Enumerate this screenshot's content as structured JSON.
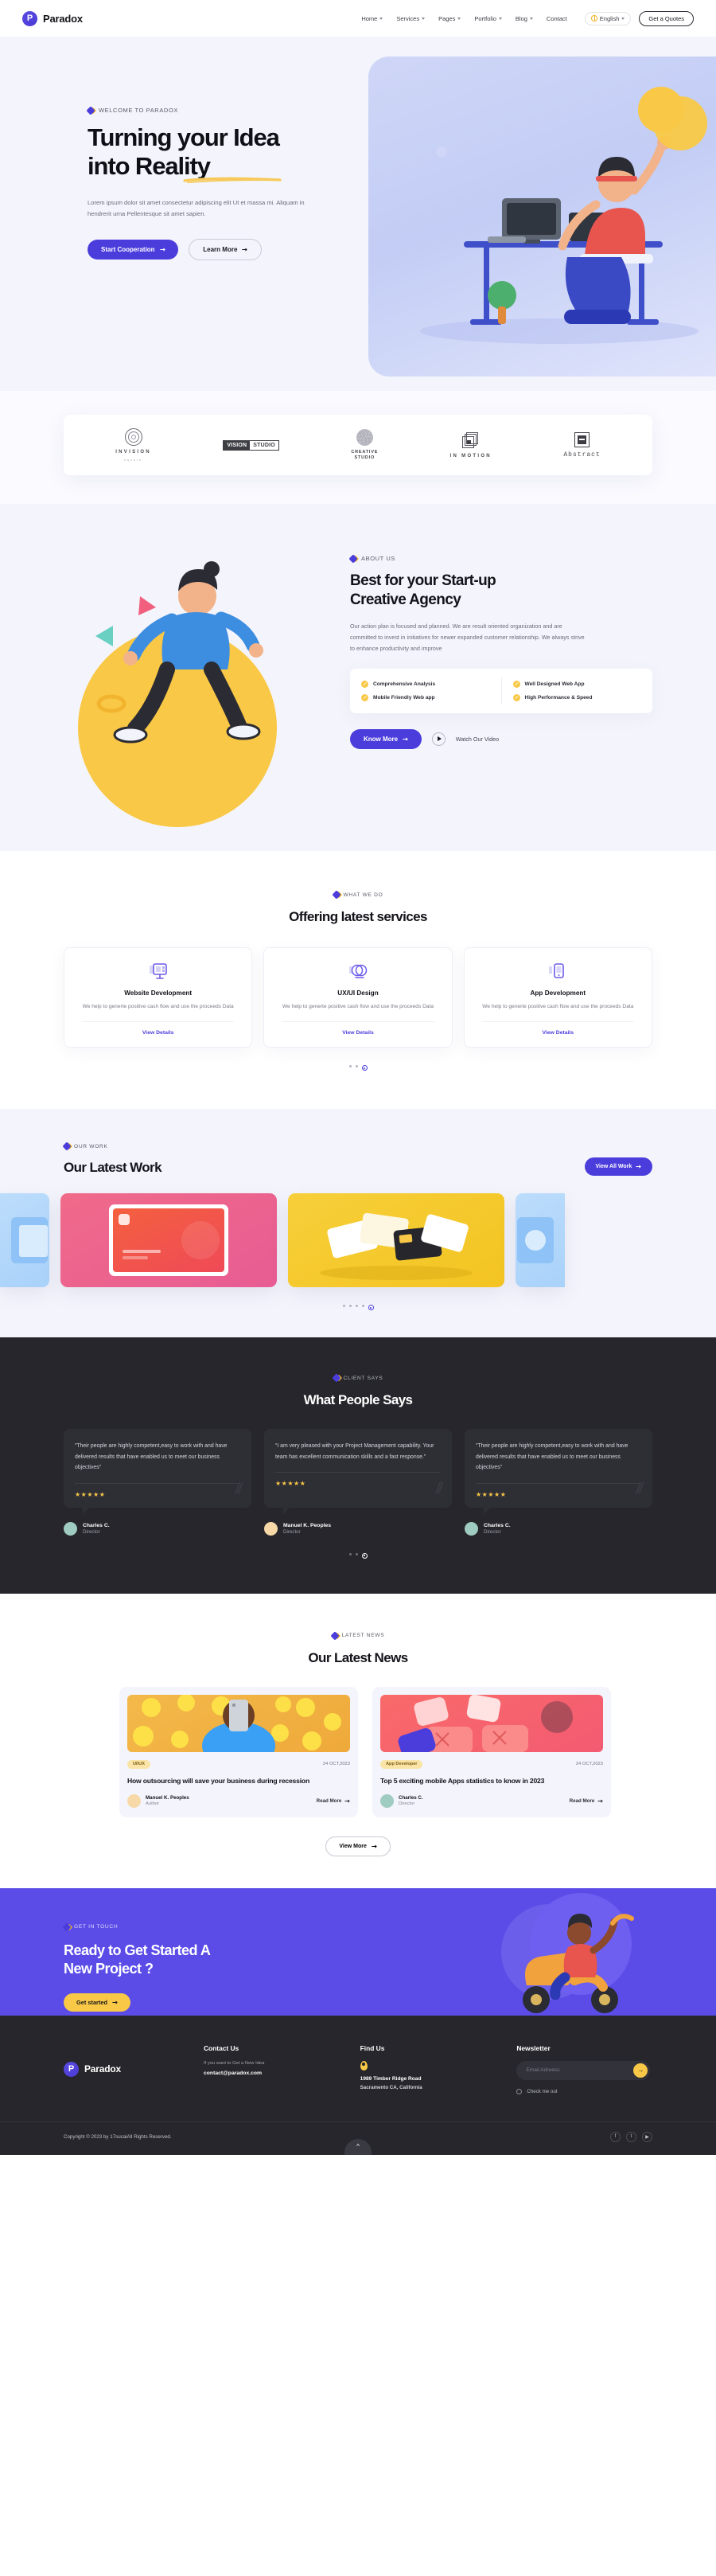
{
  "brand": {
    "name": "Paradox",
    "mark": "P"
  },
  "nav": {
    "links": [
      {
        "label": "Home",
        "has_caret": true
      },
      {
        "label": "Services",
        "has_caret": true
      },
      {
        "label": "Pages",
        "has_caret": true
      },
      {
        "label": "Portfolio",
        "has_caret": true
      },
      {
        "label": "Blog",
        "has_caret": true
      },
      {
        "label": "Contact",
        "has_caret": false
      }
    ],
    "language": "English",
    "quote_button": "Get a Quotes"
  },
  "hero": {
    "eyebrow": "WELCOME TO PARADOX",
    "title_line1": "Turning your Idea",
    "title_line2": "into Reality",
    "subtitle": "Lorem ipsum dolor sit amet consectetur adipiscing elit Ut et massa mi. Aliquam in hendrerit urna Pellentesque sit amet sapien.",
    "primary_button": "Start Cooperation",
    "secondary_button": "Learn More"
  },
  "logos": [
    {
      "name": "INVISION",
      "sub": "square",
      "icon": "mandala-icon"
    },
    {
      "name": "VISION STUDIO",
      "a": "VISION",
      "b": "STUDIO",
      "icon": "vision-studio-icon"
    },
    {
      "name": "CREATIVE STUDIO",
      "line1": "CREATIVE",
      "line2": "STUDIO",
      "icon": "creative-studio-icon"
    },
    {
      "name": "IN MOTION",
      "icon": "in-motion-icon"
    },
    {
      "name": "Abstract",
      "icon": "abstract-icon"
    }
  ],
  "about": {
    "eyebrow": "ABOUT US",
    "title_line1": "Best for your Start-up",
    "title_line2": "Creative Agency",
    "paragraph": "Our action plan is focused and planned. We are result oriented organization and are committed to invest in initiatives for newer expanded customer relationship. We always strive to enhance productivity and improve",
    "features_left": [
      "Comprehensive Analysis",
      "Mobile Friendly Web app"
    ],
    "features_right": [
      "Well Designed Web App",
      "High Performance & Speed"
    ],
    "cta_button": "Know More",
    "video_label": "Watch Our Video"
  },
  "services": {
    "eyebrow": "WHAT WE DO",
    "title": "Offering latest services",
    "cards": [
      {
        "icon": "monitor-icon",
        "name": "Website Development",
        "desc": "We help to generte positive cash flow and use the proceeds Data",
        "link": "View Details"
      },
      {
        "icon": "venn-icon",
        "name": "UX/UI Design",
        "desc": "We help to generte positive cash flow and use the proceeds Data",
        "link": "View Details"
      },
      {
        "icon": "mobile-icon",
        "name": "App Development",
        "desc": "We help to generte positive cash flow and use the proceeds Data",
        "link": "View Details"
      }
    ],
    "dots": 3,
    "active_dot": 2
  },
  "work": {
    "eyebrow": "OUR WORK",
    "title": "Our Latest Work",
    "button": "View All Work",
    "dots": 5,
    "active_dot": 4
  },
  "testimonials": {
    "eyebrow": "CLIENT SAYS",
    "title": "What People Says",
    "items": [
      {
        "quote": "“Their people are highly competent,easy to work with and have delivered results that have enabled us to meet our business objectives”",
        "stars": "★★★★★",
        "name": "Charles C.",
        "role": "Director"
      },
      {
        "quote": "“I am very pleased with your Project Management capability. Your team has excellent communication skills and a fast response.”",
        "stars": "★★★★★",
        "name": "Manuel K. Peoples",
        "role": "Director"
      },
      {
        "quote": "“Their people are highly competent,easy to work with and have delivered results that have enabled us to meet our business objectives”",
        "stars": "★★★★★",
        "name": "Charles C.",
        "role": "Director"
      }
    ],
    "dots": 3,
    "active_dot": 2
  },
  "news": {
    "eyebrow": "LATEST NEWS",
    "title": "Our Latest News",
    "cards": [
      {
        "tag": "UI/UX",
        "date": "24 OCT,2023",
        "title": "How outsourcing will save your business during recession",
        "author": "Manuel K. Peoples",
        "role": "Author",
        "read_more": "Read More"
      },
      {
        "tag": "App Developer",
        "date": "24 OCT,2023",
        "title": "Top 5 exciting mobile Apps statistics to know in 2023",
        "author": "Charles C.",
        "role": "Director",
        "read_more": "Read More"
      }
    ],
    "view_more": "View More"
  },
  "cta": {
    "eyebrow": "GET IN TOUCH",
    "title_line1": "Ready to Get Started A",
    "title_line2": "New Project ?",
    "button": "Get started"
  },
  "footer": {
    "brand": "Paradox",
    "contact": {
      "heading": "Contact Us",
      "note": "If you want to Get a New Idea",
      "email": "contact@paradox.com"
    },
    "find": {
      "heading": "Find Us",
      "address1": "1989 Timber Ridge Road",
      "address2": "Sacramento CA, California"
    },
    "newsletter": {
      "heading": "Newsletter",
      "placeholder": "Email Adreess",
      "value": "",
      "submit_icon": "arrow-right-icon",
      "checkbox_label": "Check me out"
    },
    "copyright": "Copyright © 2023 by 17sucaiAll Rights Reserved.",
    "socials": [
      "f",
      "t",
      "▶"
    ],
    "to_top_icon": "chevron-up-icon"
  },
  "colors": {
    "accent": "#4b3ddb",
    "accent_alt": "#5b4ce8",
    "yellow": "#f9c846",
    "dark": "#26262c",
    "light_bg": "#f4f5fc"
  }
}
